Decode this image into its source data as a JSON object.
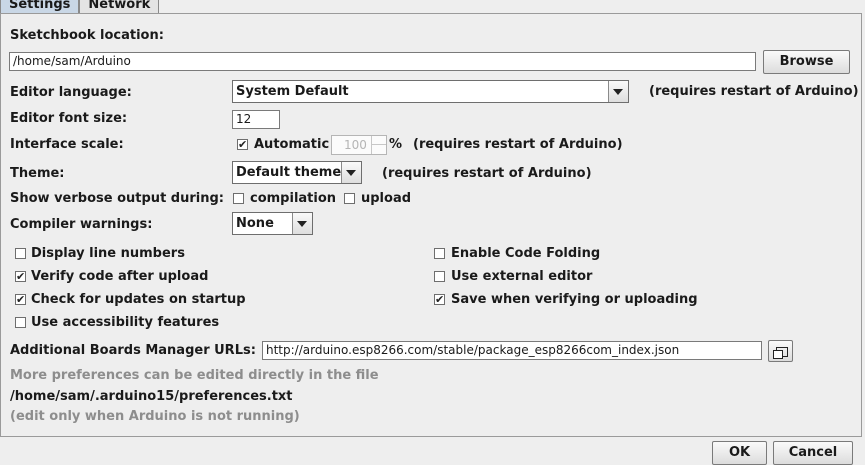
{
  "tabs": [
    {
      "label": "Settings",
      "active": true
    },
    {
      "label": "Network",
      "active": false
    }
  ],
  "sketchbook": {
    "label": "Sketchbook location:",
    "value": "/home/sam/Arduino",
    "browse_label": "Browse"
  },
  "editor_language": {
    "label": "Editor language:",
    "selected": "System Default",
    "note": "(requires restart of Arduino)"
  },
  "font_size": {
    "label": "Editor font size:",
    "value": "12"
  },
  "interface_scale": {
    "label": "Interface scale:",
    "automatic_label": "Automatic",
    "automatic_checked": true,
    "value": "100",
    "percent": "%",
    "note": "(requires restart of Arduino)"
  },
  "theme": {
    "label": "Theme:",
    "selected": "Default theme",
    "note": "(requires restart of Arduino)"
  },
  "verbose": {
    "label": "Show verbose output during:",
    "compilation_label": "compilation",
    "compilation_checked": false,
    "upload_label": "upload",
    "upload_checked": false
  },
  "compiler_warnings": {
    "label": "Compiler warnings:",
    "selected": "None"
  },
  "options_left": [
    {
      "label": "Display line numbers",
      "checked": false
    },
    {
      "label": "Verify code after upload",
      "checked": true
    },
    {
      "label": "Check for updates on startup",
      "checked": true
    },
    {
      "label": "Use accessibility features",
      "checked": false
    }
  ],
  "options_right": [
    {
      "label": "Enable Code Folding",
      "checked": false
    },
    {
      "label": "Use external editor",
      "checked": false
    },
    {
      "label": "Save when verifying or uploading",
      "checked": true
    }
  ],
  "boards_urls": {
    "label": "Additional Boards Manager URLs:",
    "value": "http://arduino.esp8266.com/stable/package_esp8266com_index.json"
  },
  "footer": {
    "more_prefs": "More preferences can be edited directly in the file",
    "prefs_path": "/home/sam/.arduino15/preferences.txt",
    "edit_note": "(edit only when Arduino is not running)"
  },
  "buttons": {
    "ok": "OK",
    "cancel": "Cancel"
  },
  "checkmark": "✔"
}
